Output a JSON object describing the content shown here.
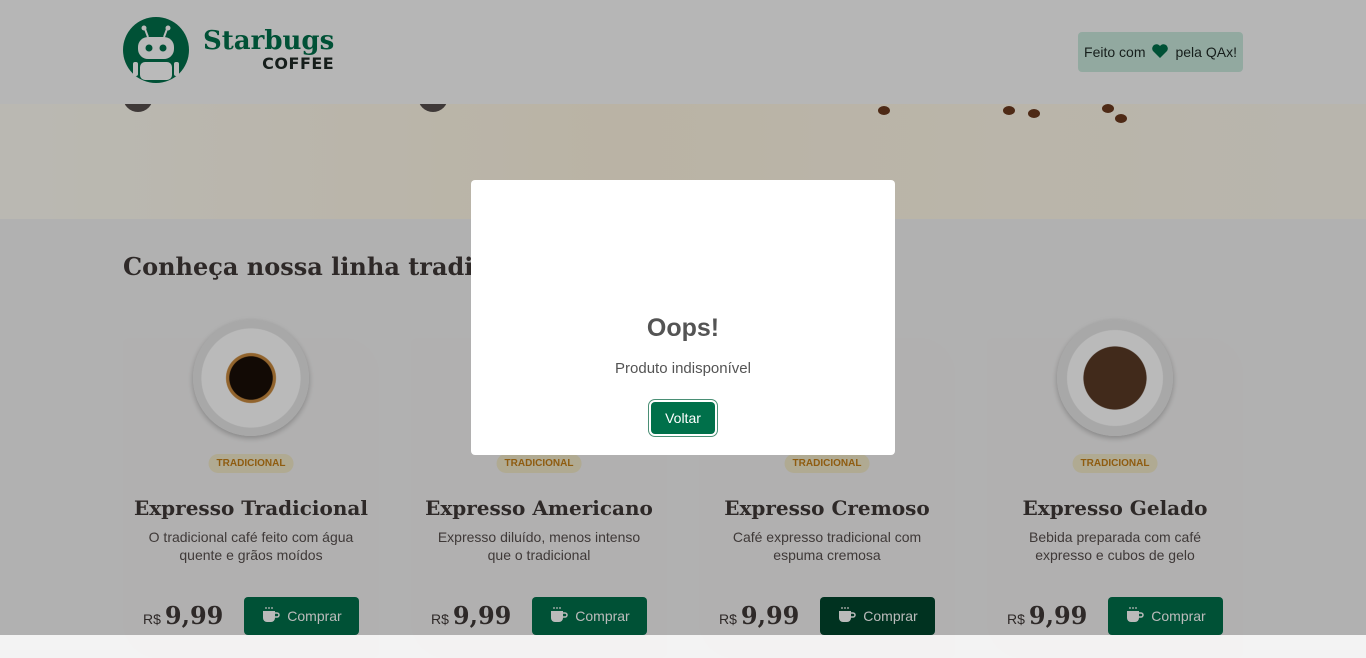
{
  "header": {
    "brand_name": "Starbugs",
    "brand_sub": "COFFEE",
    "made_by_prefix": "Feito com",
    "made_by_suffix": "pela QAx!"
  },
  "main": {
    "section_title": "Conheça nossa linha tradicional"
  },
  "products": [
    {
      "tag": "TRADICIONAL",
      "name": "Expresso Tradicional",
      "description": "O tradicional café feito com água quente e grãos moídos",
      "currency": "R$",
      "price": "9,99",
      "buy_label": "Comprar"
    },
    {
      "tag": "TRADICIONAL",
      "name": "Expresso Americano",
      "description": "Expresso diluído, menos intenso que o tradicional",
      "currency": "R$",
      "price": "9,99",
      "buy_label": "Comprar"
    },
    {
      "tag": "TRADICIONAL",
      "name": "Expresso Cremoso",
      "description": "Café expresso tradicional com espuma cremosa",
      "currency": "R$",
      "price": "9,99",
      "buy_label": "Comprar"
    },
    {
      "tag": "TRADICIONAL",
      "name": "Expresso Gelado",
      "description": "Bebida preparada com café expresso e cubos de gelo",
      "currency": "R$",
      "price": "9,99",
      "buy_label": "Comprar"
    }
  ],
  "modal": {
    "title": "Oops!",
    "message": "Produto indisponível",
    "button_label": "Voltar"
  },
  "icons": {
    "logo": "robot-logo-icon",
    "heart": "heart-icon",
    "buy": "coffee-cup-icon"
  },
  "colors": {
    "brand_green": "#00704a",
    "brand_green_dark": "#00452d",
    "badge_bg": "#c9e8dc",
    "tag_text": "#c47f17",
    "tag_bg": "#f1e9c9"
  }
}
